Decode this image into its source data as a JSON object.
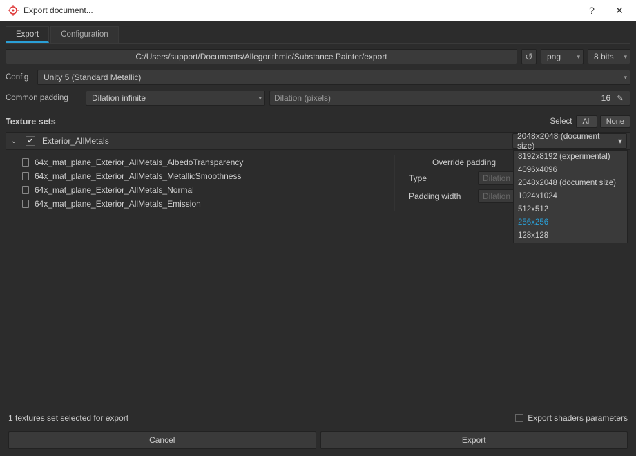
{
  "window": {
    "title": "Export document...",
    "help": "?",
    "close": "✕"
  },
  "tabs": {
    "export": "Export",
    "configuration": "Configuration"
  },
  "pathbar": {
    "path": "C:/Users/support/Documents/Allegorithmic/Substance Painter/export",
    "format": "png",
    "bitdepth": "8 bits"
  },
  "config": {
    "label": "Config",
    "preset": "Unity 5 (Standard Metallic)"
  },
  "padding": {
    "label": "Common padding",
    "mode": "Dilation infinite",
    "pixels_label": "Dilation (pixels)",
    "pixels_value": "16"
  },
  "texture_sets": {
    "title": "Texture sets",
    "select_label": "Select",
    "all": "All",
    "none": "None"
  },
  "set": {
    "name": "Exterior_AllMetals",
    "maps": [
      "64x_mat_plane_Exterior_AllMetals_AlbedoTransparency",
      "64x_mat_plane_Exterior_AllMetals_MetallicSmoothness",
      "64x_mat_plane_Exterior_AllMetals_Normal",
      "64x_mat_plane_Exterior_AllMetals_Emission"
    ],
    "size_selected": "2048x2048 (document size)",
    "size_options": [
      "8192x8192 (experimental)",
      "4096x4096",
      "2048x2048 (document size)",
      "1024x1024",
      "512x512",
      "256x256",
      "128x128"
    ],
    "size_highlight_index": 5,
    "override_padding": "Override padding",
    "type_label": "Type",
    "type_value": "Dilation",
    "padding_width_label": "Padding width",
    "padding_width_value": "Dilation"
  },
  "status": {
    "text": "1 textures set selected for export",
    "shaders": "Export shaders parameters"
  },
  "buttons": {
    "cancel": "Cancel",
    "export": "Export"
  }
}
